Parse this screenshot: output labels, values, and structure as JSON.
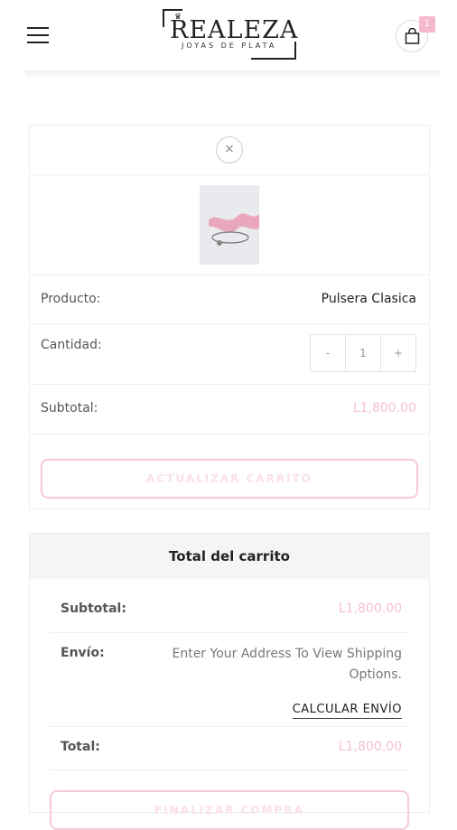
{
  "header": {
    "logo_title": "REALEZA",
    "logo_subtitle": "JOYAS DE PLATA",
    "cart_count": "1"
  },
  "cart_item": {
    "remove_symbol": "×",
    "product_label": "Producto:",
    "product_name": "Pulsera Clasica",
    "quantity_label": "Cantidad:",
    "qty_minus": "-",
    "qty_value": "1",
    "qty_plus": "+",
    "subtotal_label": "Subtotal:",
    "subtotal_value": "L1,800.00",
    "update_button": "ACTUALIZAR CARRITO"
  },
  "totals": {
    "title": "Total del carrito",
    "subtotal_label": "Subtotal:",
    "subtotal_value": "L1,800.00",
    "shipping_label": "Envío:",
    "shipping_text": "Enter Your Address To View Shipping Options.",
    "calculate_link": "CALCULAR ENVÍO",
    "total_label": "Total:",
    "total_value": "L1,800.00",
    "checkout_button": "FINALIZAR COMPRA"
  },
  "colors": {
    "accent": "#f6b9cd",
    "accent_light": "#fbe0e9"
  }
}
